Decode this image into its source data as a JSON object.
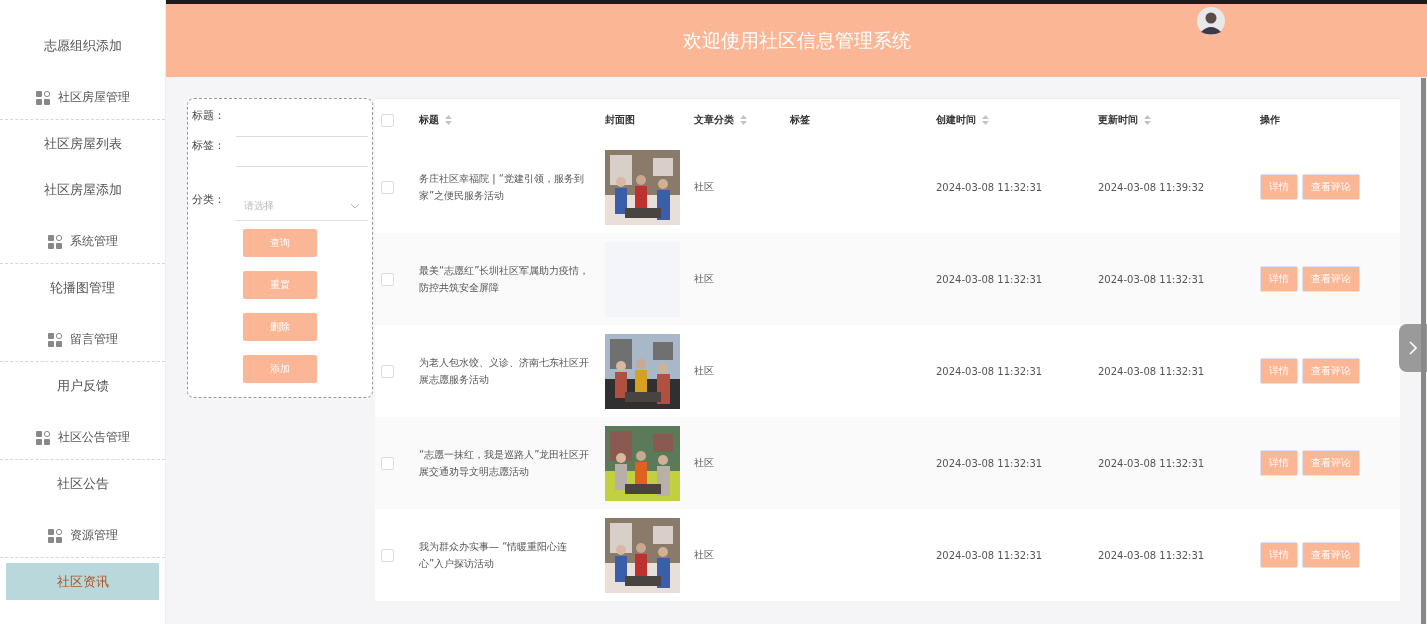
{
  "sidebar": {
    "items": [
      {
        "label": "志愿组织添加",
        "kind": "link",
        "selected": false
      },
      {
        "label": "社区房屋管理",
        "kind": "group"
      },
      {
        "label": "社区房屋列表",
        "kind": "link",
        "selected": false
      },
      {
        "label": "社区房屋添加",
        "kind": "link",
        "selected": false
      },
      {
        "label": "系统管理",
        "kind": "group"
      },
      {
        "label": "轮播图管理",
        "kind": "link",
        "selected": false
      },
      {
        "label": "留言管理",
        "kind": "group"
      },
      {
        "label": "用户反馈",
        "kind": "link",
        "selected": false
      },
      {
        "label": "社区公告管理",
        "kind": "group"
      },
      {
        "label": "社区公告",
        "kind": "link",
        "selected": false
      },
      {
        "label": "资源管理",
        "kind": "group"
      },
      {
        "label": "社区资讯",
        "kind": "link",
        "selected": true
      }
    ]
  },
  "header": {
    "title": "欢迎使用社区信息管理系统"
  },
  "filter": {
    "fields": [
      {
        "label": "标题：",
        "kind": "text"
      },
      {
        "label": "标签：",
        "kind": "text"
      },
      {
        "label": "分类：",
        "kind": "select",
        "placeholder": "请选择"
      }
    ],
    "buttons": [
      "查询",
      "重置",
      "删除",
      "添加"
    ]
  },
  "table": {
    "columns": [
      {
        "label": "标题",
        "sortable": true
      },
      {
        "label": "封面图",
        "sortable": false
      },
      {
        "label": "文章分类",
        "sortable": true
      },
      {
        "label": "标签",
        "sortable": false
      },
      {
        "label": "创建时间",
        "sortable": true
      },
      {
        "label": "更新时间",
        "sortable": true
      },
      {
        "label": "操作",
        "sortable": false
      }
    ],
    "header_checked": false,
    "rows": [
      {
        "checked": false,
        "title": "务庄社区幸福院 | “党建引领，服务到家”之便民服务活动",
        "has_cover": true,
        "category": "社区",
        "created": "2024-03-08 11:32:31",
        "updated": "2024-03-08 11:39:32",
        "actions": [
          "详情",
          "查看评论"
        ]
      },
      {
        "checked": false,
        "title": "最美“志愿红”长圳社区军属助力疫情，防控共筑安全屏障",
        "has_cover": false,
        "category": "社区",
        "created": "2024-03-08 11:32:31",
        "updated": "2024-03-08 11:32:31",
        "actions": [
          "详情",
          "查看评论"
        ]
      },
      {
        "checked": false,
        "title": "为老人包水饺、义诊、济南七东社区开展志愿服务活动",
        "has_cover": true,
        "category": "社区",
        "created": "2024-03-08 11:32:31",
        "updated": "2024-03-08 11:32:31",
        "actions": [
          "详情",
          "查看评论"
        ]
      },
      {
        "checked": false,
        "title": "“志愿一抹红，我是巡路人”龙田社区开展交通劝导文明志愿活动",
        "has_cover": true,
        "category": "社区",
        "created": "2024-03-08 11:32:31",
        "updated": "2024-03-08 11:32:31",
        "actions": [
          "详情",
          "查看评论"
        ]
      },
      {
        "checked": false,
        "title": "我为群众办实事— “情暖重阳心连心”入户探访活动",
        "has_cover": true,
        "category": "社区",
        "created": "2024-03-08 11:32:31",
        "updated": "2024-03-08 11:32:31",
        "actions": [
          "详情",
          "查看评论"
        ]
      }
    ]
  }
}
